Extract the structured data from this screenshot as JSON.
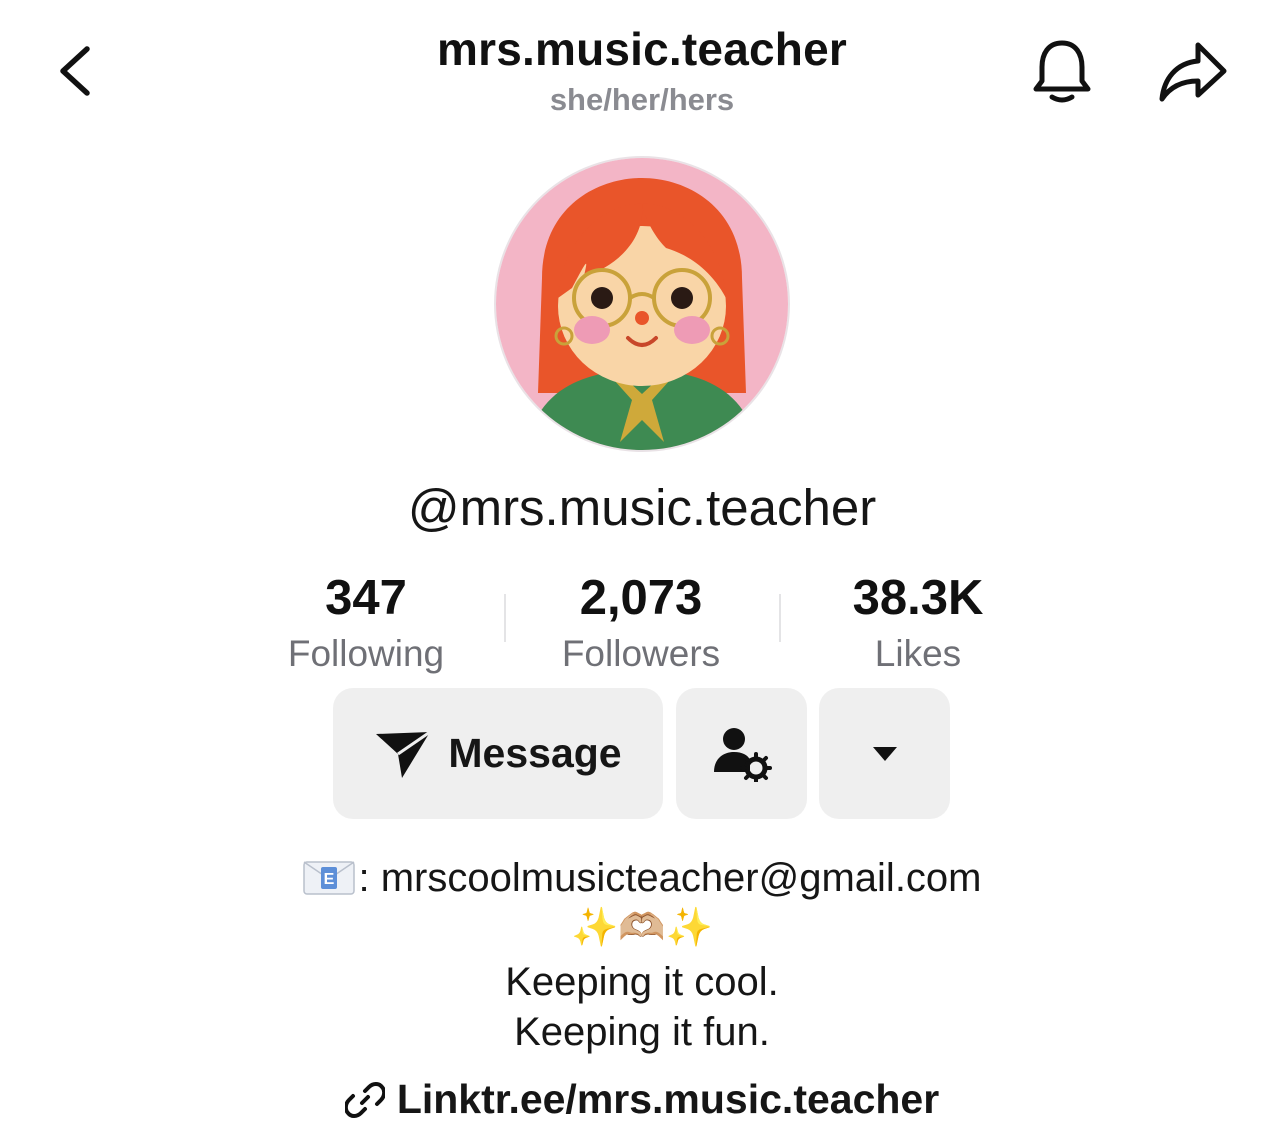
{
  "header": {
    "title": "mrs.music.teacher",
    "pronouns": "she/her/hers",
    "back_icon": "chevron-left-icon",
    "bell_icon": "bell-icon",
    "share_icon": "share-arrow-icon"
  },
  "profile": {
    "handle": "@mrs.music.teacher",
    "avatar": "illustrated-avatar-red-haired-woman-with-glasses"
  },
  "stats": [
    {
      "value": "347",
      "label": "Following"
    },
    {
      "value": "2,073",
      "label": "Followers"
    },
    {
      "value": "38.3K",
      "label": "Likes"
    }
  ],
  "actions": {
    "message_label": "Message",
    "message_icon": "paper-plane-icon",
    "friend_icon": "person-gear-icon",
    "more_icon": "caret-down-icon"
  },
  "bio": {
    "email_prefix": ": ",
    "email": "mrscoolmusicteacher@gmail.com",
    "sparkles": "✨🫶🏼✨",
    "line1": "Keeping it cool.",
    "line2": "Keeping it fun."
  },
  "link": {
    "text": "Linktr.ee/mrs.music.teacher",
    "icon": "link-chain-icon"
  },
  "colors": {
    "text": "#161616",
    "muted": "#6f7076",
    "button_bg": "#efefef",
    "avatar_bg": "#f3b5c6",
    "hair": "#e9552a",
    "shirt": "#3e8a52"
  }
}
